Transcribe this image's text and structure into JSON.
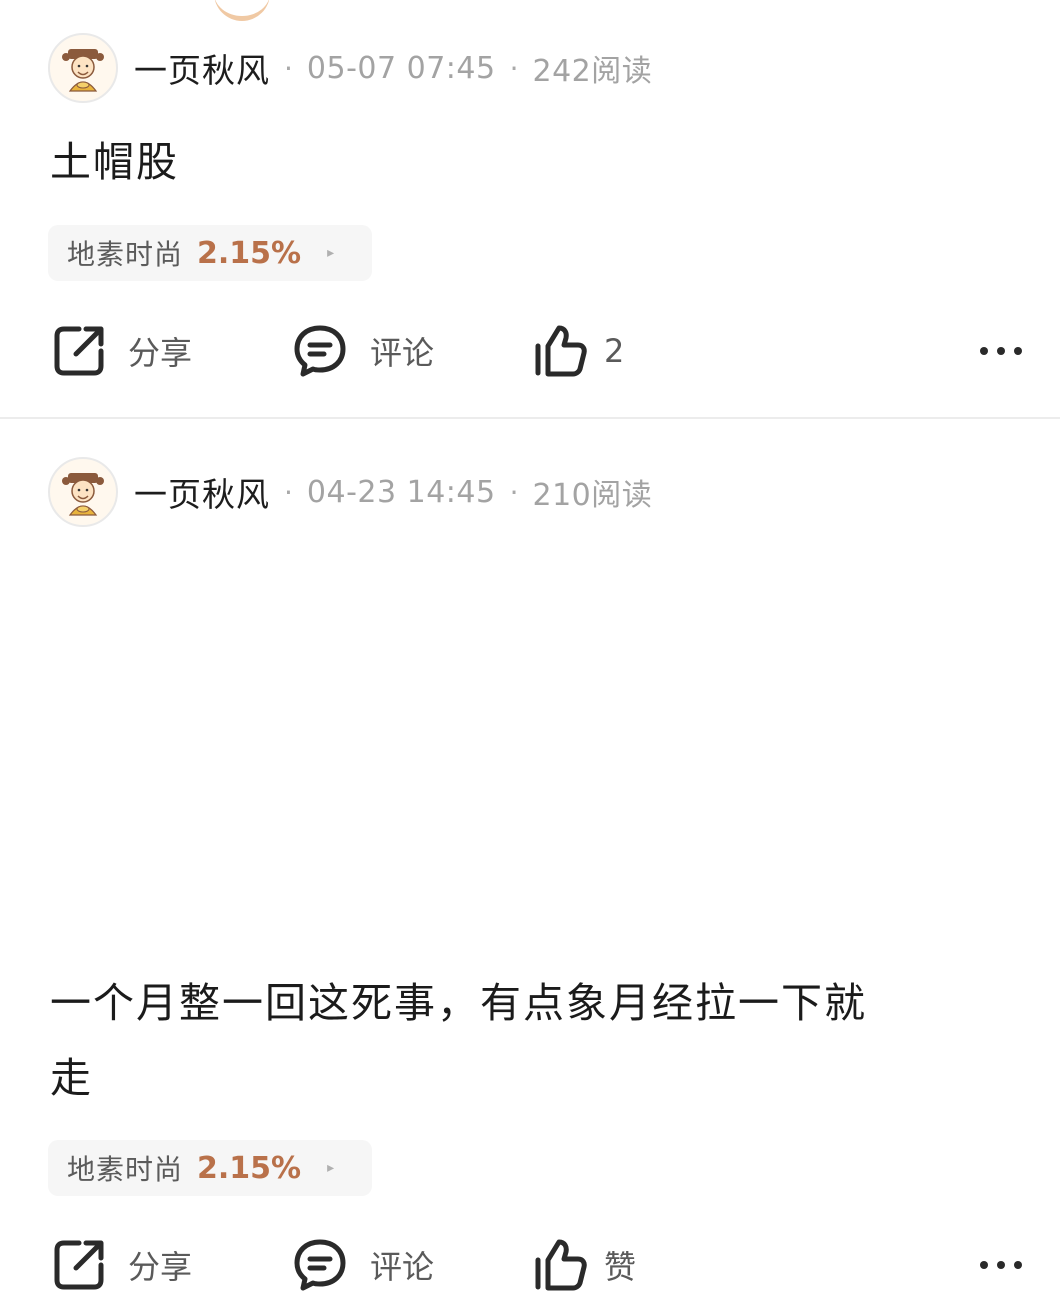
{
  "colors": {
    "accent_change": "#b9714a",
    "meta_text": "#a3a3a3",
    "tag_bg": "#f6f6f6"
  },
  "posts": [
    {
      "author": "一页秋风",
      "date": "05-07 07:45",
      "separator": "·",
      "reads": "242阅读",
      "content": "土帽股",
      "content_line2": "",
      "stock": {
        "name": "地素时尚",
        "change": "2.15%",
        "arrow": "▸"
      },
      "actions": {
        "share": "分享",
        "comment": "评论",
        "like": "2",
        "more_icon": "more-dots-icon"
      }
    },
    {
      "author": "一页秋风",
      "date": "04-23 14:45",
      "separator": "·",
      "reads": "210阅读",
      "content": "一个月整一回这死事，有点象月经拉一下就",
      "content_line2": "走",
      "stock": {
        "name": "地素时尚",
        "change": "2.15%",
        "arrow": "▸"
      },
      "actions": {
        "share": "分享",
        "comment": "评论",
        "like": "赞",
        "more_icon": "more-dots-icon"
      }
    }
  ]
}
